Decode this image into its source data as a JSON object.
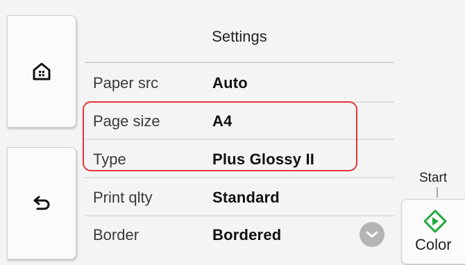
{
  "screen": {
    "title": "Settings"
  },
  "nav": {
    "home_icon": "home-icon",
    "back_icon": "back-arrow-icon"
  },
  "settings": [
    {
      "label": "Paper src",
      "value": "Auto"
    },
    {
      "label": "Page size",
      "value": "A4"
    },
    {
      "label": "Type",
      "value": "Plus Glossy II"
    },
    {
      "label": "Print qlty",
      "value": "Standard"
    },
    {
      "label": "Border",
      "value": "Bordered"
    }
  ],
  "highlight": {
    "color": "#e3343a",
    "covers": [
      "Page size",
      "Type"
    ]
  },
  "scroll": {
    "icon": "chevron-down-icon"
  },
  "start": {
    "label": "Start",
    "button_label": "Color",
    "icon": "start-diamond-icon",
    "accent_color": "#1fa83b"
  }
}
